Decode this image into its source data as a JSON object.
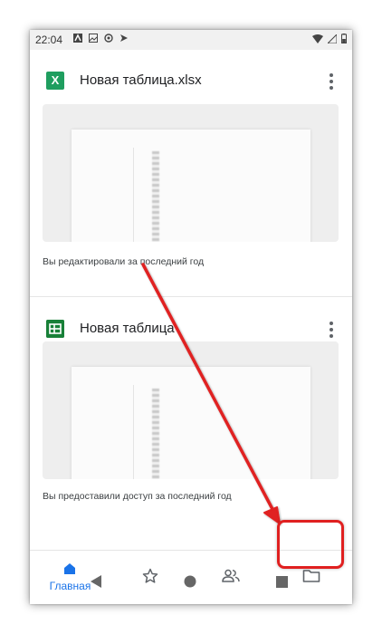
{
  "status_bar": {
    "time": "22:04"
  },
  "files": [
    {
      "icon": "xlsx-file-icon",
      "icon_glyph": "X",
      "name": "Новая таблица.xlsx",
      "caption": "Вы редактировали за последний год"
    },
    {
      "icon": "sheets-file-icon",
      "icon_glyph": "",
      "name": "Новая таблица",
      "caption": "Вы предоставили доступ за последний год"
    }
  ],
  "bottom_nav": {
    "home_label": "Главная",
    "items": [
      "home-icon",
      "star-icon",
      "shared-people-icon",
      "folder-icon"
    ],
    "accent_color": "#1a73e8"
  },
  "annotation": {
    "color": "#e02020",
    "target": "folder-icon"
  }
}
